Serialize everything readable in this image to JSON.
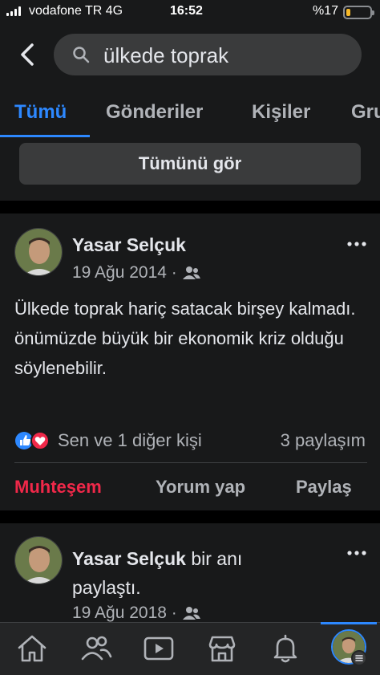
{
  "status": {
    "carrier": "vodafone TR 4G",
    "time": "16:52",
    "battery": "%17",
    "battery_level": 0.17
  },
  "search": {
    "query": "ülkede toprak"
  },
  "tabs": [
    {
      "label": "Tümü",
      "active": true
    },
    {
      "label": "Gönderiler",
      "active": false
    },
    {
      "label": "Kişiler",
      "active": false
    },
    {
      "label": "Gru",
      "active": false
    }
  ],
  "see_all_label": "Tümünü gör",
  "posts": [
    {
      "author": "Yasar Selçuk",
      "date": "19 Ağu 2014 ·",
      "audience_icon": "friends-icon",
      "text": "Ülkede toprak hariç satacak birşey kalmadı. önümüzde büyük bir ekonomik kriz olduğu söylenebilir.",
      "reactions": "Sen ve 1 diğer kişi",
      "shares": "3 paylaşım",
      "actions": {
        "react": "Muhteşem",
        "comment": "Yorum yap",
        "share": "Paylaş"
      }
    },
    {
      "author": "Yasar Selçuk",
      "author_suffix": "bir anı",
      "line2": "paylaştı.",
      "date": "19 Ağu 2018 ·",
      "audience_icon": "friends-icon"
    }
  ],
  "bottom_nav": [
    "home-icon",
    "friends-icon",
    "watch-icon",
    "marketplace-icon",
    "notifications-icon",
    "profile-menu"
  ],
  "colors": {
    "background": "#18191a",
    "surface": "#3a3b3c",
    "accent": "#2d88ff",
    "love": "#f02849",
    "text": "#e4e6eb",
    "muted": "#b0b3b8"
  }
}
